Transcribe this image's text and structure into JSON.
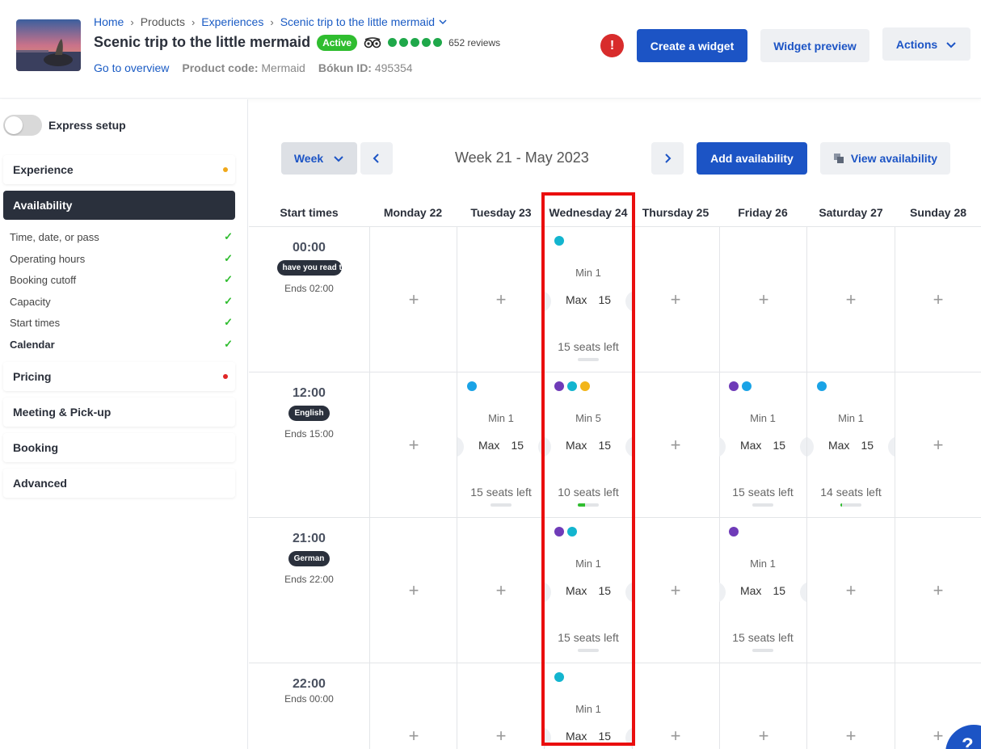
{
  "breadcrumb": {
    "home": "Home",
    "products": "Products",
    "experiences": "Experiences",
    "current": "Scenic trip to the little mermaid"
  },
  "product": {
    "title": "Scenic trip to the little mermaid",
    "status": "Active",
    "reviews": "652 reviews",
    "go_to_overview": "Go to overview",
    "product_code_label": "Product code:",
    "product_code": "Mermaid",
    "bokun_id_label": "Bókun ID:",
    "bokun_id": "495354"
  },
  "header_actions": {
    "alert_icon": "!",
    "create_widget": "Create a widget",
    "widget_preview": "Widget preview",
    "actions": "Actions"
  },
  "sidebar": {
    "express_setup": "Express setup",
    "sections": [
      {
        "label": "Experience",
        "status_color": "#f0a81a"
      },
      {
        "label": "Availability",
        "active": true
      },
      {
        "label": "Pricing",
        "status_color": "#e02626"
      },
      {
        "label": "Meeting & Pick-up"
      },
      {
        "label": "Booking"
      },
      {
        "label": "Advanced"
      }
    ],
    "availability_items": [
      {
        "label": "Time, date, or pass",
        "check": "✓"
      },
      {
        "label": "Operating hours",
        "check": "✓"
      },
      {
        "label": "Booking cutoff",
        "check": "✓"
      },
      {
        "label": "Capacity",
        "check": "✓"
      },
      {
        "label": "Start times",
        "check": "✓"
      },
      {
        "label": "Calendar",
        "check": "✓"
      }
    ]
  },
  "toolbar": {
    "view_mode": "Week",
    "week_title": "Week 21 - May 2023",
    "add_availability": "Add availability",
    "view_availability": "View availability"
  },
  "calendar": {
    "start_times_header": "Start times",
    "days": [
      "Monday 22",
      "Tuesday 23",
      "Wednesday 24",
      "Thursday 25",
      "Friday 26",
      "Saturday 27",
      "Sunday 28"
    ],
    "rows": [
      {
        "time": "00:00",
        "pill": "have you read the",
        "ends": "Ends 02:00"
      },
      {
        "time": "12:00",
        "pill": "English",
        "ends": "Ends 15:00"
      },
      {
        "time": "21:00",
        "pill": "German",
        "ends": "Ends 22:00"
      },
      {
        "time": "22:00",
        "pill": "",
        "ends": "Ends 00:00"
      }
    ],
    "add_icon": "+",
    "dot_colors": {
      "cyan": "#13b5cf",
      "blue": "#1aa3e6",
      "purple": "#6f3bb8",
      "amber": "#f2b51a"
    },
    "slots": {
      "r0_wed": {
        "min": "Min 1",
        "max_label": "Max",
        "max": "15",
        "seats": "15 seats left",
        "booked": 0
      },
      "r1_tue": {
        "min": "Min 1",
        "max_label": "Max",
        "max": "15",
        "seats": "15 seats left",
        "booked": 0
      },
      "r1_wed": {
        "min": "Min 5",
        "max_label": "Max",
        "max": "15",
        "seats": "10 seats left",
        "booked": 0.33
      },
      "r1_fri": {
        "min": "Min 1",
        "max_label": "Max",
        "max": "15",
        "seats": "15 seats left",
        "booked": 0
      },
      "r1_sat": {
        "min": "Min 1",
        "max_label": "Max",
        "max": "15",
        "seats": "14 seats left",
        "booked": 0.07
      },
      "r2_wed": {
        "min": "Min 1",
        "max_label": "Max",
        "max": "15",
        "seats": "15 seats left",
        "booked": 0
      },
      "r2_fri": {
        "min": "Min 1",
        "max_label": "Max",
        "max": "15",
        "seats": "15 seats left",
        "booked": 0
      },
      "r3_wed": {
        "min": "Min 1",
        "max_label": "Max",
        "max": "15",
        "seats": "",
        "booked": 0
      }
    }
  },
  "help_label": "?"
}
